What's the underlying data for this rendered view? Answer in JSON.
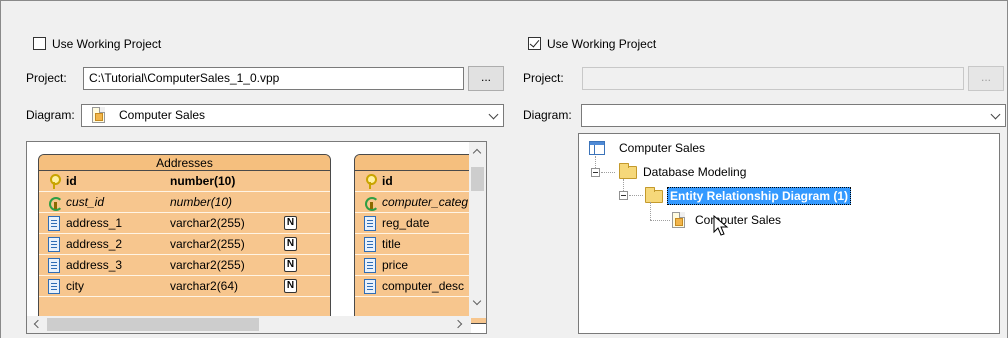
{
  "left": {
    "use_working_project_label": "Use Working Project",
    "use_working_project_checked": false,
    "project_label": "Project:",
    "project_value": "C:\\Tutorial\\ComputerSales_1_0.vpp",
    "browse_label": "...",
    "diagram_label": "Diagram:",
    "diagram_value": "Computer Sales",
    "preview": {
      "entity1": {
        "title": "Addresses",
        "rows": [
          {
            "name": "id",
            "type": "number(10)",
            "icon": "primary-key-icon",
            "not_null": ""
          },
          {
            "name": "cust_id",
            "type": "number(10)",
            "icon": "foreign-key-icon",
            "not_null": ""
          },
          {
            "name": "address_1",
            "type": "varchar2(255)",
            "icon": "column-icon",
            "not_null": "N"
          },
          {
            "name": "address_2",
            "type": "varchar2(255)",
            "icon": "column-icon",
            "not_null": "N"
          },
          {
            "name": "address_3",
            "type": "varchar2(255)",
            "icon": "column-icon",
            "not_null": "N"
          },
          {
            "name": "city",
            "type": "varchar2(64)",
            "icon": "column-icon",
            "not_null": "N"
          }
        ]
      },
      "entity2": {
        "rows": [
          {
            "name": "id",
            "icon": "primary-key-icon"
          },
          {
            "name": "computer_categ",
            "icon": "foreign-key-icon"
          },
          {
            "name": "reg_date",
            "icon": "column-icon"
          },
          {
            "name": "title",
            "icon": "column-icon"
          },
          {
            "name": "price",
            "icon": "column-icon"
          },
          {
            "name": "computer_desc",
            "icon": "column-icon"
          }
        ]
      }
    }
  },
  "right": {
    "use_working_project_label": "Use Working Project",
    "use_working_project_checked": true,
    "project_label": "Project:",
    "project_value": "",
    "browse_label": "...",
    "diagram_label": "Diagram:",
    "diagram_value": "",
    "tree": {
      "root": "Computer Sales",
      "folder1": "Database Modeling",
      "folder2": "Entity Relationship Diagram (1)",
      "leaf": "Computer Sales"
    }
  },
  "colors": {
    "entity_fill": "#f7c68e",
    "selection": "#3399ff",
    "window_bg": "#f0f0f0"
  }
}
